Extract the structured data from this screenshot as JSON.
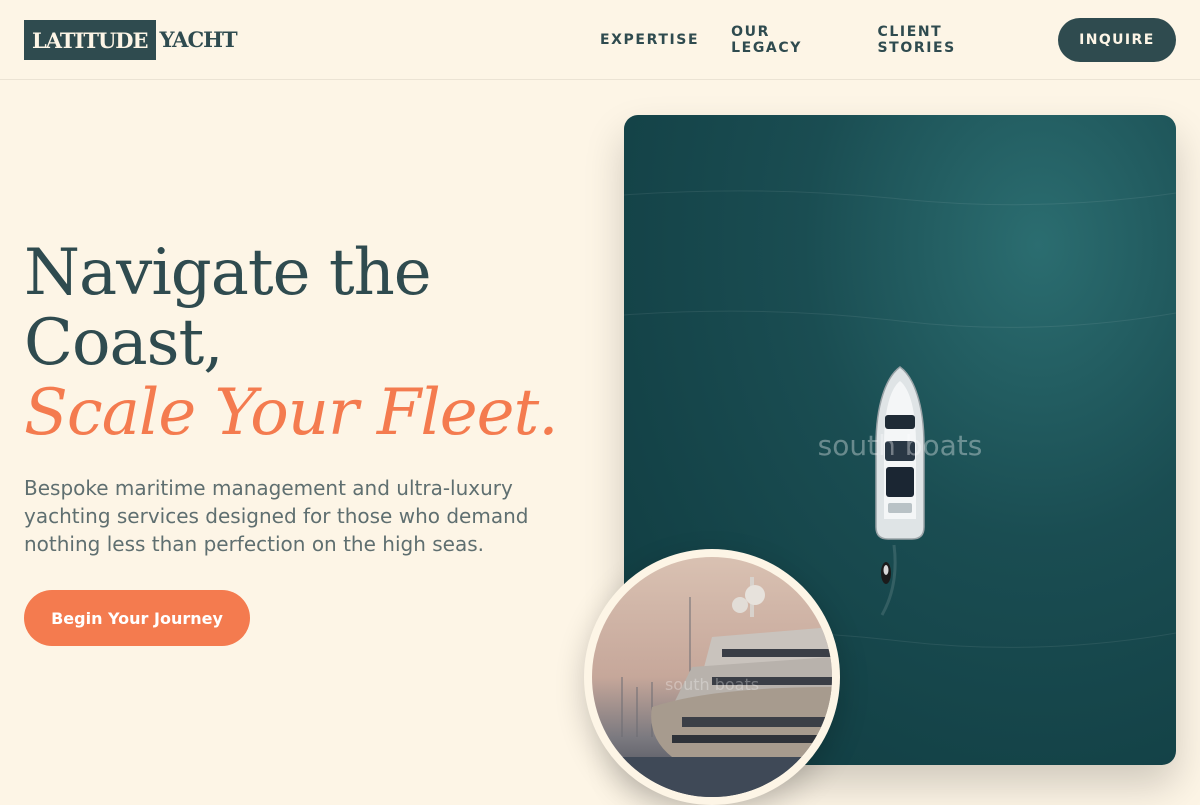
{
  "brand": {
    "logo_box": "LATITUDE",
    "logo_text": "YACHT"
  },
  "nav": {
    "links": [
      "EXPERTISE",
      "OUR LEGACY",
      "CLIENT STORIES"
    ],
    "cta": "INQUIRE"
  },
  "hero": {
    "line1": "Navigate the",
    "line2": "Coast,",
    "line3": "Scale Your Fleet.",
    "subtext": "Bespoke maritime management and ultra-luxury yachting services designed for those who demand nothing less than perfection on the high seas.",
    "cta": "Begin Your Journey"
  },
  "images": {
    "main_watermark": "south boats",
    "inset_watermark": "south boats"
  },
  "colors": {
    "background": "#fdf5e6",
    "primary": "#2f4b4f",
    "accent": "#f47b4f"
  }
}
